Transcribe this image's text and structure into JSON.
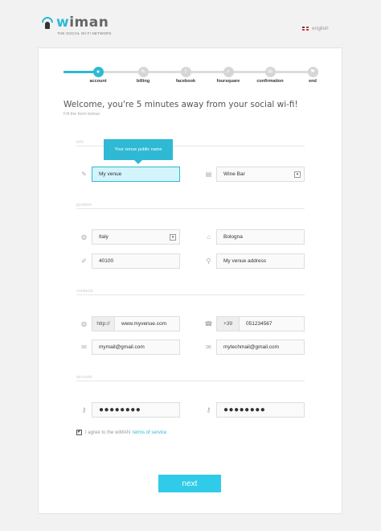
{
  "header": {
    "logo_prefix": "w",
    "logo_rest": "iman",
    "tagline": "THE SOCIAL WI-FI NETWORK",
    "language": "english"
  },
  "steps": [
    {
      "label": "account",
      "icon": "user-icon",
      "glyph": "●",
      "active": true
    },
    {
      "label": "billing",
      "icon": "pencil-icon",
      "glyph": "✎",
      "active": false
    },
    {
      "label": "facebook",
      "icon": "facebook-icon",
      "glyph": "f",
      "active": false
    },
    {
      "label": "foursquare",
      "icon": "foursquare-icon",
      "glyph": "✓",
      "active": false
    },
    {
      "label": "confirmation",
      "icon": "envelope-icon",
      "glyph": "✉",
      "active": false
    },
    {
      "label": "end",
      "icon": "flag-icon",
      "glyph": "⚑",
      "active": false
    }
  ],
  "welcome": "Welcome, you're 5 minutes away from your social wi-fi!",
  "subtitle": "Fill the form below:",
  "sections": {
    "info": "info",
    "position": "position",
    "contacts": "contacts",
    "account": "account"
  },
  "tooltip": "Your venue public name",
  "info": {
    "venue_name": "My venue",
    "venue_type": "Wine Bar"
  },
  "position": {
    "country": "Italy",
    "city": "Bologna",
    "zip": "40100",
    "address": "My venue address"
  },
  "contacts": {
    "web_prefix": "http://",
    "website": "www.myvenue.com",
    "phone_prefix": "+39",
    "phone": "051234567",
    "email": "mymail@gmail.com",
    "tech_email": "mytechmail@gmail.com"
  },
  "account": {
    "password": "●●●●●●●●",
    "password_confirm": "●●●●●●●●"
  },
  "terms": {
    "checked_glyph": "✔",
    "text": "I agree to the wiMAN",
    "link": "terms of service"
  },
  "next_label": "next",
  "colors": {
    "accent": "#2fb9d4",
    "button": "#2fcbe8"
  }
}
